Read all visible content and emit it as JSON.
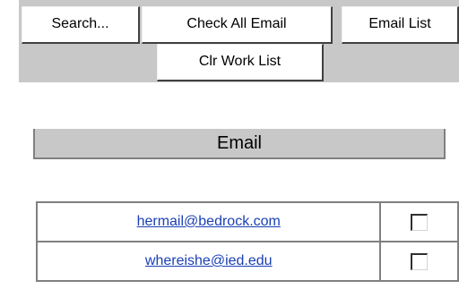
{
  "toolbar": {
    "search_label": "Search...",
    "check_all_label": "Check All Email",
    "email_list_label": "Email List",
    "clr_work_list_label": "Clr Work List"
  },
  "email_section": {
    "header": "Email"
  },
  "emails": [
    {
      "address": "hermail@bedrock.com",
      "checked": false
    },
    {
      "address": "whereishe@ied.edu",
      "checked": false
    }
  ]
}
